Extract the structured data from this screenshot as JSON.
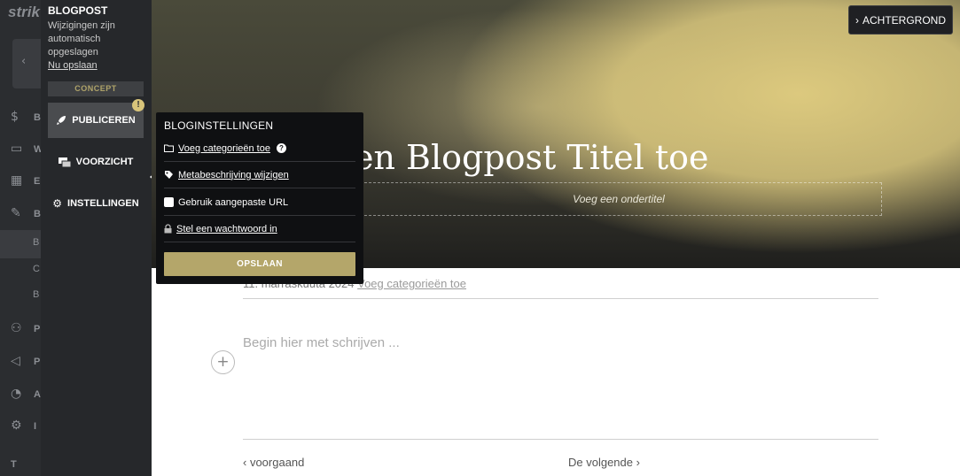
{
  "leftnav": {
    "brand": "strik",
    "back_arrow": "‹",
    "items": [
      {
        "icon": "dollar-icon",
        "glyph": "$",
        "letter": "B"
      },
      {
        "icon": "store-icon",
        "glyph": "▭",
        "letter": "W"
      },
      {
        "icon": "calendar-icon",
        "glyph": "▦",
        "letter": "E"
      },
      {
        "icon": "pen-icon",
        "glyph": "✎",
        "letter": "B"
      },
      {
        "icon": "users-icon",
        "glyph": "⚇",
        "letter": "P"
      },
      {
        "icon": "megaphone-icon",
        "glyph": "◁",
        "letter": "P"
      },
      {
        "icon": "chart-icon",
        "glyph": "◔",
        "letter": "A"
      },
      {
        "icon": "settings-icon",
        "glyph": "⚙",
        "letter": "I"
      }
    ],
    "subitems": [
      "B",
      "C",
      "B"
    ],
    "last": "T"
  },
  "panel": {
    "title": "BLOGPOST",
    "status": "Wijzigingen zijn automatisch opgeslagen",
    "save_link": "Nu opslaan",
    "badge": "CONCEPT",
    "publish": "PUBLICEREN",
    "warning": "!",
    "preview": "VOORZICHT",
    "settings": "INSTELLINGEN"
  },
  "hero": {
    "background_button": "ACHTERGROND",
    "title": "en Blogpost Titel toe",
    "subtitle_placeholder": "Voeg een ondertitel"
  },
  "popover": {
    "heading": "BLOGINSTELLINGEN",
    "categories": "Voeg categorieën toe",
    "help": "?",
    "meta": "Metabeschrijving wijzigen",
    "custom_url": "Gebruik aangepaste URL",
    "password": "Stel een wachtwoord in",
    "save": "OPSLAAN"
  },
  "content": {
    "date": "11. marraskuuta 2024",
    "add_categories": "Voeg categorieën toe",
    "placeholder": "Begin hier met schrijven ...",
    "plus": "+",
    "prev": "voorgaand",
    "next": "De volgende"
  },
  "colors": {
    "panel": "#26282b",
    "accent": "#b4a66a",
    "popover": "#0f1012"
  }
}
